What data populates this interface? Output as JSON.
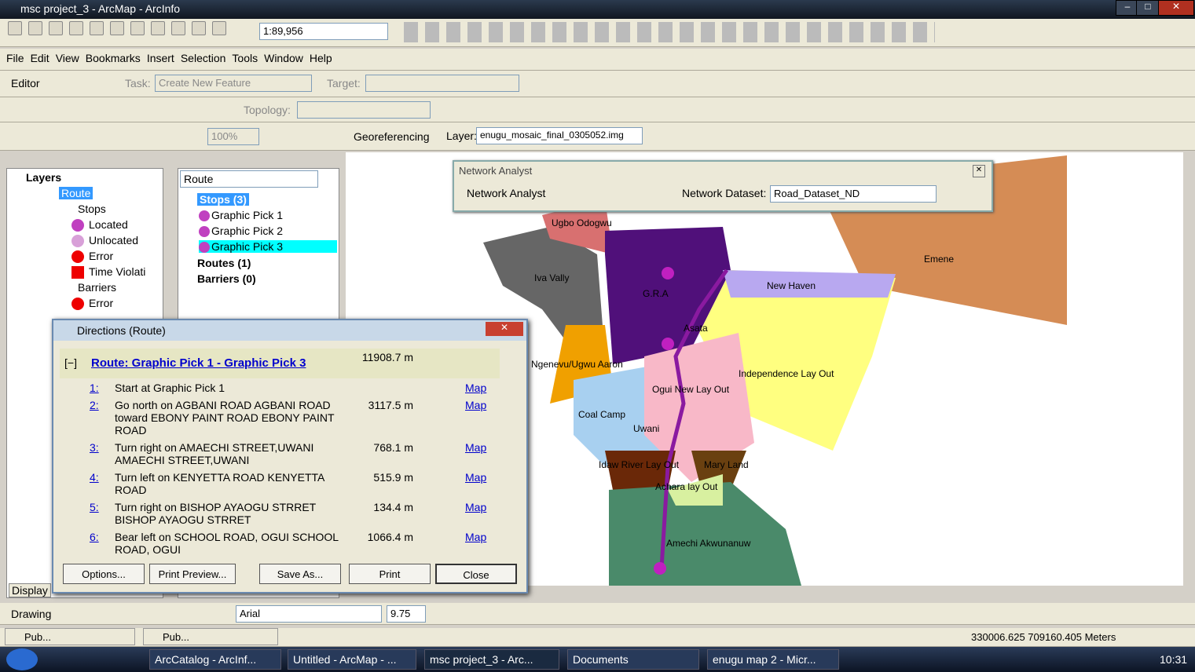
{
  "window": {
    "title": "msc project_3 - ArcMap - ArcInfo"
  },
  "toolbar": {
    "scale": "1:89,956"
  },
  "menu": [
    "File",
    "Edit",
    "View",
    "Bookmarks",
    "Insert",
    "Selection",
    "Tools",
    "Window",
    "Help"
  ],
  "editor": {
    "label": "Editor",
    "task_label": "Task:",
    "task_value": "Create New Feature",
    "target_label": "Target:",
    "topology_label": "Topology:"
  },
  "georef": {
    "label": "Georeferencing",
    "layer_label": "Layer:",
    "layer_value": "enugu_mosaic_final_0305052.img",
    "zoom": "100%"
  },
  "toc": {
    "title": "Layers",
    "route": "Route",
    "stops": "Stops",
    "located": "Located",
    "unlocated": "Unlocated",
    "error": "Error",
    "time": "Time Violati",
    "barriers": "Barriers",
    "berror": "Error",
    "display_tab": "Display"
  },
  "nawindow": {
    "combo": "Route",
    "stops": "Stops (3)",
    "p1": "Graphic Pick 1",
    "p2": "Graphic Pick 2",
    "p3": "Graphic Pick 3",
    "routes": "Routes (1)",
    "barriers": "Barriers (0)"
  },
  "na": {
    "title": "Network Analyst",
    "menu": "Network Analyst",
    "ds_label": "Network Dataset:",
    "ds_value": "Road_Dataset_ND"
  },
  "directions": {
    "title": "Directions (Route)",
    "expand": "[−]",
    "route": "Route: Graphic Pick 1 - Graphic Pick 3",
    "total": "11908.7 m",
    "rows": [
      {
        "n": "1:",
        "t": "Start at Graphic Pick 1",
        "d": "",
        "m": "Map"
      },
      {
        "n": "2:",
        "t": "Go north on AGBANI ROAD AGBANI ROAD toward EBONY PAINT ROAD EBONY PAINT ROAD",
        "d": "3117.5 m",
        "m": "Map"
      },
      {
        "n": "3:",
        "t": "Turn right on AMAECHI STREET,UWANI AMAECHI STREET,UWANI",
        "d": "768.1 m",
        "m": "Map"
      },
      {
        "n": "4:",
        "t": "Turn left on KENYETTA ROAD KENYETTA ROAD",
        "d": "515.9 m",
        "m": "Map"
      },
      {
        "n": "5:",
        "t": "Turn right on BISHOP AYAOGU STRRET BISHOP AYAOGU STRRET",
        "d": "134.4 m",
        "m": "Map"
      },
      {
        "n": "6:",
        "t": "Bear left on SCHOOL ROAD, OGUI SCHOOL ROAD, OGUI",
        "d": "1066.4 m",
        "m": "Map"
      }
    ],
    "buttons": [
      "Options...",
      "Print Preview...",
      "Save As...",
      "Print",
      "Close"
    ]
  },
  "maplabels": [
    "Ugbo Odogwu",
    "Iva Vally",
    "G.R.A",
    "Emene",
    "New Haven",
    "Asata",
    "Ngenevu/Ugwu Aaron",
    "Independence Lay Out",
    "Ogui New Lay Out",
    "Coal Camp",
    "Uwani",
    "Idaw River Lay Out",
    "Mary Land",
    "Achara lay Out",
    "Amechi Akwunanuw"
  ],
  "drawing": {
    "label": "Drawing",
    "font": "Arial",
    "size": "9.75"
  },
  "status": {
    "coords": "330006.625  709160.405 Meters"
  },
  "pub": [
    "Pub...",
    "Pub..."
  ],
  "taskbar": {
    "items": [
      "ArcCatalog - ArcInf...",
      "Untitled - ArcMap - ...",
      "msc project_3 - Arc...",
      "Documents",
      "enugu map 2 - Micr..."
    ],
    "clock": "10:31"
  }
}
